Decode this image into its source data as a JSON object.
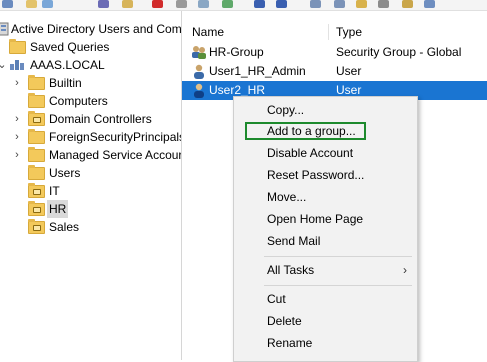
{
  "tree": {
    "root": "Active Directory Users and Com",
    "items": [
      {
        "label": "Saved Queries"
      },
      {
        "label": "AAAS.LOCAL"
      },
      {
        "label": "Builtin"
      },
      {
        "label": "Computers"
      },
      {
        "label": "Domain Controllers"
      },
      {
        "label": "ForeignSecurityPrincipals"
      },
      {
        "label": "Managed Service Accour"
      },
      {
        "label": "Users"
      },
      {
        "label": "IT"
      },
      {
        "label": "HR"
      },
      {
        "label": "Sales"
      }
    ]
  },
  "list": {
    "columns": {
      "name": "Name",
      "type": "Type"
    },
    "rows": [
      {
        "name": "HR-Group",
        "type": "Security Group - Global"
      },
      {
        "name": "User1_HR_Admin",
        "type": "User"
      },
      {
        "name": "User2_HR",
        "type": "User"
      }
    ]
  },
  "context_menu": {
    "items": [
      {
        "label": "Copy..."
      },
      {
        "label": "Add to a group..."
      },
      {
        "label": "Disable Account"
      },
      {
        "label": "Reset Password..."
      },
      {
        "label": "Move..."
      },
      {
        "label": "Open Home Page"
      },
      {
        "label": "Send Mail"
      },
      {
        "label": "All Tasks",
        "arrow": "›"
      },
      {
        "label": "Cut"
      },
      {
        "label": "Delete"
      },
      {
        "label": "Rename"
      }
    ]
  },
  "colors": {
    "selection": "#1a75d2",
    "highlight_box": "#1d8a2d",
    "folder": "#f3c95b"
  }
}
